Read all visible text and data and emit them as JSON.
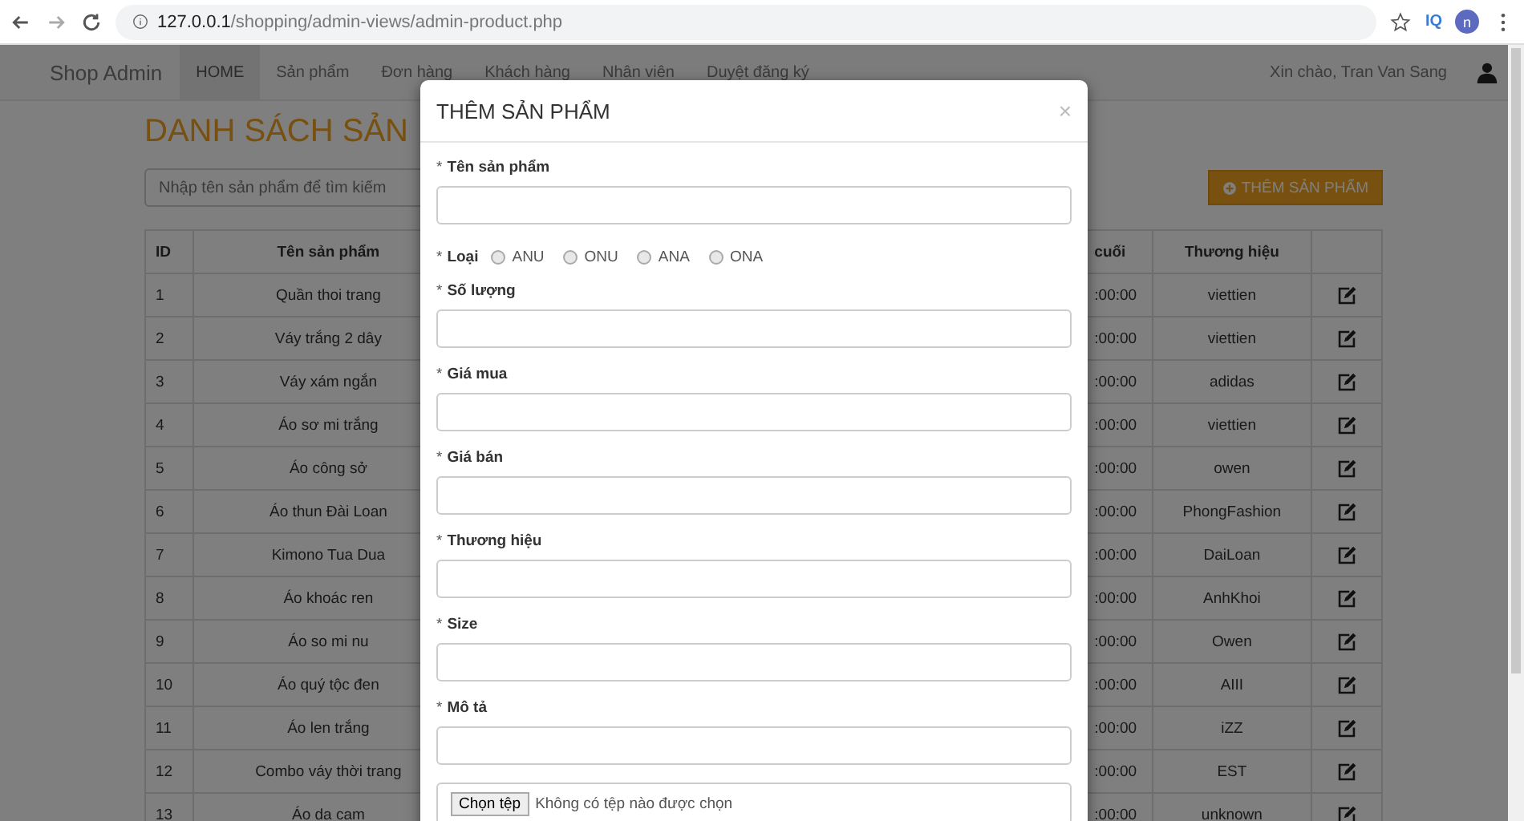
{
  "browser": {
    "url_host": "127.0.0.1",
    "url_path": "/shopping/admin-views/admin-product.php",
    "profile_initial": "n",
    "extension_label": "IQ"
  },
  "navbar": {
    "brand": "Shop Admin",
    "items": [
      {
        "label": "HOME",
        "selected": true
      },
      {
        "label": "Sản phẩm",
        "selected": false
      },
      {
        "label": "Đơn hàng",
        "selected": false
      },
      {
        "label": "Khách hàng",
        "selected": false
      },
      {
        "label": "Nhân viên",
        "selected": false
      },
      {
        "label": "Duyệt đăng ký",
        "selected": false
      }
    ],
    "greeting": "Xin chào, Tran Van Sang"
  },
  "page": {
    "title": "DANH SÁCH SẢN",
    "search": {
      "placeholder": "Nhập tên sản phẩm để tìm kiếm"
    },
    "add_button": "THÊM SẢN PHẨM"
  },
  "table": {
    "columns": [
      "ID",
      "Tên sản phẩm",
      "",
      "cuối",
      "Thương hiệu"
    ],
    "rows": [
      {
        "id": "1",
        "name": "Quần thoi trang",
        "column_4": ":00:00",
        "brand": "viettien"
      },
      {
        "id": "2",
        "name": "Váy trắng 2 dây",
        "column_4": ":00:00",
        "brand": "viettien"
      },
      {
        "id": "3",
        "name": "Váy xám ngắn",
        "column_4": ":00:00",
        "brand": "adidas"
      },
      {
        "id": "4",
        "name": "Áo sơ mi trắng",
        "column_4": ":00:00",
        "brand": "viettien"
      },
      {
        "id": "5",
        "name": "Áo công sở",
        "column_4": ":00:00",
        "brand": "owen"
      },
      {
        "id": "6",
        "name": "Áo thun Đài Loan",
        "column_4": ":00:00",
        "brand": "PhongFashion"
      },
      {
        "id": "7",
        "name": "Kimono Tua Dua",
        "column_4": ":00:00",
        "brand": "DaiLoan"
      },
      {
        "id": "8",
        "name": "Áo khoác ren",
        "column_4": ":00:00",
        "brand": "AnhKhoi"
      },
      {
        "id": "9",
        "name": "Áo so mi nu",
        "column_4": ":00:00",
        "brand": "Owen"
      },
      {
        "id": "10",
        "name": "Áo quý tộc đen",
        "column_4": ":00:00",
        "brand": "AIII"
      },
      {
        "id": "11",
        "name": "Áo len trắng",
        "column_4": ":00:00",
        "brand": "iZZ"
      },
      {
        "id": "12",
        "name": "Combo váy thời trang",
        "column_4": ":00:00",
        "brand": "EST"
      },
      {
        "id": "13",
        "name": "Áo da cam",
        "column_4": ":00:00",
        "brand": "unknown"
      }
    ]
  },
  "modal": {
    "title": "THÊM SẢN PHẨM",
    "close": "×",
    "fields": [
      {
        "kind": "text",
        "mark": "*",
        "label": "Tên sản phẩm"
      },
      {
        "kind": "radio",
        "mark": "*",
        "label": "Loại",
        "options": [
          {
            "label": "ANU",
            "selected": false
          },
          {
            "label": "ONU",
            "selected": false
          },
          {
            "label": "ANA",
            "selected": false
          },
          {
            "label": "ONA",
            "selected": false
          }
        ]
      },
      {
        "kind": "text",
        "mark": "*",
        "label": "Số lượng"
      },
      {
        "kind": "text",
        "mark": "*",
        "label": "Giá mua"
      },
      {
        "kind": "text",
        "mark": "*",
        "label": "Giá bán"
      },
      {
        "kind": "text",
        "mark": "*",
        "label": "Thương hiệu"
      },
      {
        "kind": "text",
        "mark": "*",
        "label": "Size"
      },
      {
        "kind": "text",
        "mark": "*",
        "label": "Mô tả"
      },
      {
        "kind": "file",
        "button": "Chọn tệp",
        "status": "Không có tệp nào được chọn"
      }
    ]
  }
}
